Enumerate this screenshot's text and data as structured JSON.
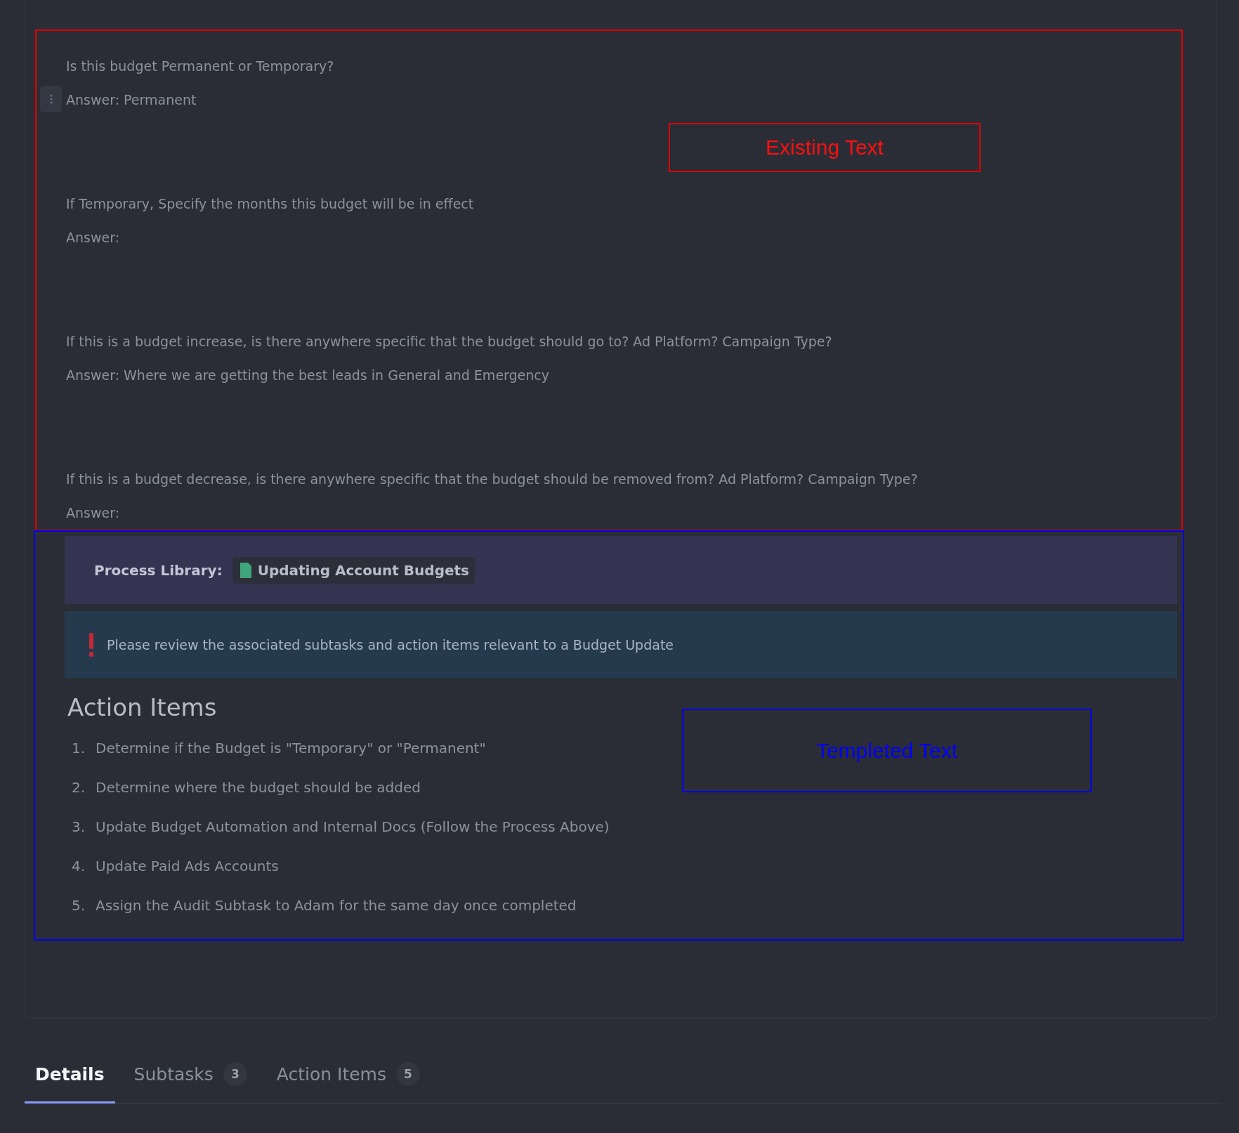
{
  "existing_text": {
    "label": "Existing Text",
    "paragraphs": [
      {
        "question": "Is this budget Permanent or Temporary?",
        "answer": "Answer: Permanent",
        "handle": true
      },
      {
        "question": "If Temporary, Specify the months this budget will be in effect",
        "answer": "Answer:",
        "handle": false
      },
      {
        "question": "If this is a budget increase, is there anywhere specific that the budget should go to? Ad Platform? Campaign Type?",
        "answer": "Answer: Where we are getting the best leads in General and Emergency",
        "handle": false
      },
      {
        "question": "If this is a budget decrease, is there anywhere specific that the budget should be removed from? Ad Platform? Campaign Type?",
        "answer": "Answer:",
        "handle": false
      }
    ]
  },
  "templated_text": {
    "label": "Templeted Text",
    "process_library": {
      "label": "Process Library:",
      "link": "Updating Account Budgets"
    },
    "notice": {
      "text": "Please review the associated subtasks and action items relevant to a Budget Update"
    },
    "action_items": {
      "heading": "Action Items",
      "items": [
        {
          "number": "1.",
          "text": "Determine if the Budget is \"Temporary\" or \"Permanent\""
        },
        {
          "number": "2.",
          "text": "Determine where the budget should be added"
        },
        {
          "number": "3.",
          "text": "Update Budget Automation and Internal Docs (Follow the Process Above)"
        },
        {
          "number": "4.",
          "text": "Update Paid Ads Accounts"
        },
        {
          "number": "5.",
          "text": "Assign the Audit Subtask to Adam for the same day once completed"
        }
      ]
    }
  },
  "tabs": [
    {
      "label": "Details",
      "selected": true
    },
    {
      "label": "Subtasks",
      "count": "3",
      "selected": false
    },
    {
      "label": "Action Items",
      "count": "5",
      "selected": false
    }
  ]
}
